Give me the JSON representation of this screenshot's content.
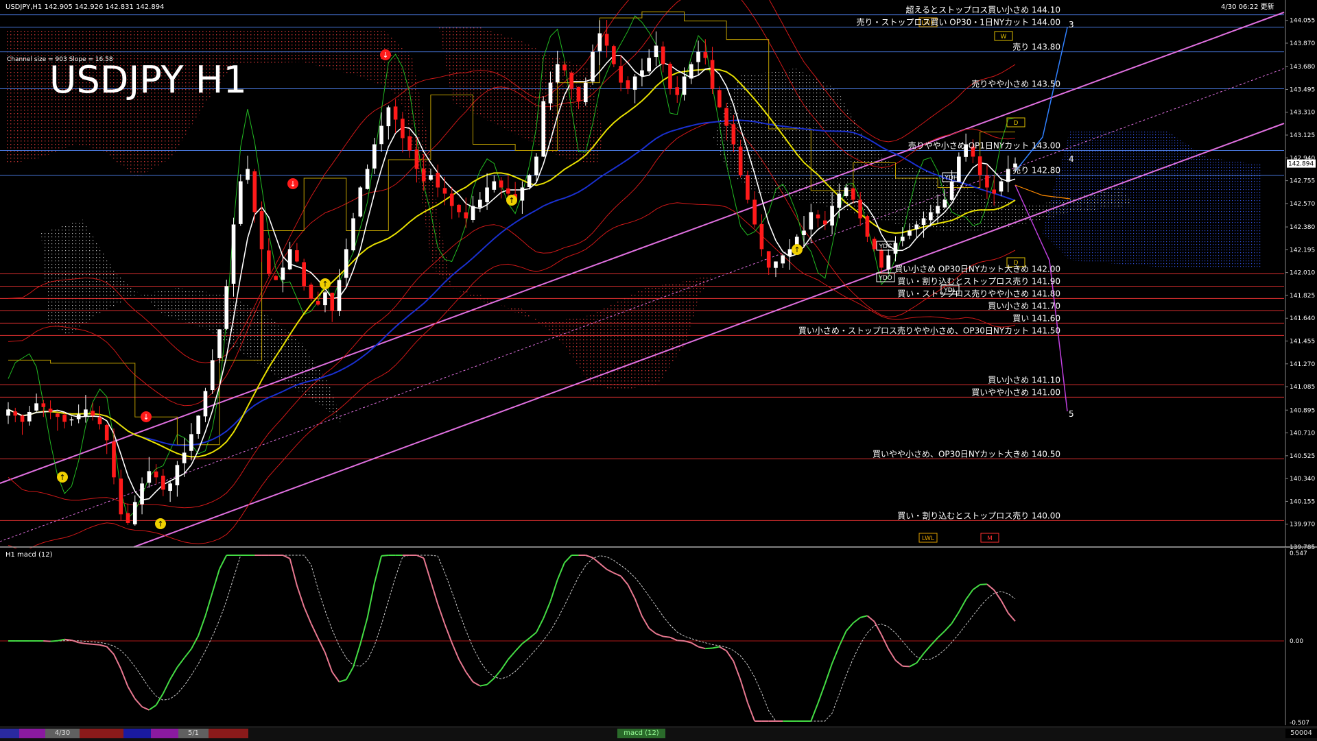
{
  "header": {
    "symbol_info": "USDJPY,H1  142.905 142.926 142.831 142.894",
    "timestamp": "4/30 06:22 更新",
    "big_title": "USDJPY H1",
    "channel_info": "Channel size = 903 Slope = 16.58"
  },
  "price_axis": {
    "labels": [
      "144.055",
      "143.870",
      "143.680",
      "143.495",
      "143.310",
      "143.125",
      "142.940",
      "142.755",
      "142.570",
      "142.380",
      "142.195",
      "142.010",
      "141.825",
      "141.640",
      "141.455",
      "141.270",
      "141.085",
      "140.895",
      "140.710",
      "140.525",
      "140.340",
      "140.155",
      "139.970",
      "139.785"
    ],
    "current_price": "142.894"
  },
  "levels": [
    {
      "label": "超えるとストップロス買い小さめ 144.10",
      "price": 144.1,
      "color": "#4a7ae0"
    },
    {
      "label": "売り・ストップロス買い OP30・1日NYカット 144.00",
      "price": 144.0,
      "color": "#4a7ae0"
    },
    {
      "label": "売り 143.80",
      "price": 143.8,
      "color": "#4a7ae0"
    },
    {
      "label": "売りやや小さめ 143.50",
      "price": 143.5,
      "color": "#4a7ae0"
    },
    {
      "label": "売りやや小さめ OP1日NYカット 143.00",
      "price": 143.0,
      "color": "#4a7ae0"
    },
    {
      "label": "売り 142.80",
      "price": 142.8,
      "color": "#4a7ae0"
    },
    {
      "label": "買い小さめ OP30日NYカット大きめ 142.00",
      "price": 142.0,
      "color": "#e03030"
    },
    {
      "label": "買い・割り込むとストップロス売り 141.90",
      "price": 141.9,
      "color": "#e03030"
    },
    {
      "label": "買い・ストップロス売りやや小さめ 141.80",
      "price": 141.8,
      "color": "#e03030"
    },
    {
      "label": "買い小さめ 141.70",
      "price": 141.7,
      "color": "#e03030"
    },
    {
      "label": "買い 141.60",
      "price": 141.6,
      "color": "#e03030"
    },
    {
      "label": "買い小さめ・ストップロス売りやや小さめ、OP30日NYカット 141.50",
      "price": 141.5,
      "color": "#e03030"
    },
    {
      "label": "買い小さめ 141.10",
      "price": 141.1,
      "color": "#e03030"
    },
    {
      "label": "買いやや小さめ 141.00",
      "price": 141.0,
      "color": "#e03030"
    },
    {
      "label": "買いやや小さめ、OP30日NYカット大きめ 140.50",
      "price": 140.5,
      "color": "#e03030"
    },
    {
      "label": "買い・割り込むとストップロス売り 140.00",
      "price": 140.0,
      "color": "#e03030"
    }
  ],
  "wave_labels": [
    "3",
    "4",
    "5"
  ],
  "markers": {
    "ydh": "YDH",
    "ydl": "YDL",
    "ydc": "YDC",
    "ydo": "YDO",
    "lwh": "LWH",
    "lwl": "LWL",
    "w": "W",
    "d": "D",
    "m": "M"
  },
  "macd": {
    "title": "H1  macd (12)",
    "labels": [
      "0.547",
      "0.00",
      "-0.507"
    ],
    "macd_color": "#44dd44",
    "signal_color": "#cccccc"
  },
  "tabs": {
    "date1": "4/30",
    "date2": "5/1",
    "center": "macd (12)",
    "right": "50004"
  },
  "colors": {
    "ma_fast": "#ffffff",
    "ma_mid": "#e8e000",
    "ma_slow": "#1a30d0",
    "channel": "#e070e0",
    "bull_candle": "#ffffff",
    "bear_candle": "#ff1a1a"
  },
  "chart_data": {
    "type": "candlestick",
    "title": "USDJPY H1",
    "ylim": [
      139.785,
      144.22
    ],
    "series": [
      {
        "name": "USDJPY H1",
        "close_path": [
          140.9,
          140.85,
          140.8,
          140.88,
          140.95,
          140.92,
          140.88,
          140.84,
          140.8,
          140.82,
          140.86,
          140.9,
          140.85,
          140.78,
          140.65,
          140.35,
          140.05,
          139.98,
          140.15,
          140.3,
          140.4,
          140.35,
          140.25,
          140.3,
          140.45,
          140.55,
          140.7,
          140.85,
          141.05,
          141.3,
          141.55,
          141.9,
          142.4,
          142.75,
          142.85,
          142.5,
          142.2,
          142.0,
          141.95,
          142.05,
          142.2,
          142.1,
          141.9,
          141.8,
          141.75,
          141.85,
          141.7,
          141.95,
          142.2,
          142.45,
          142.7,
          142.85,
          143.05,
          143.2,
          143.35,
          143.25,
          143.1,
          143.0,
          142.85,
          142.75,
          142.8,
          142.7,
          142.65,
          142.55,
          142.5,
          142.45,
          142.55,
          142.6,
          142.7,
          142.75,
          142.7,
          142.65,
          142.6,
          142.7,
          142.8,
          142.95,
          143.4,
          143.55,
          143.7,
          143.65,
          143.5,
          143.4,
          143.55,
          143.8,
          143.95,
          143.85,
          143.7,
          143.55,
          143.5,
          143.6,
          143.65,
          143.75,
          143.85,
          143.7,
          143.5,
          143.45,
          143.6,
          143.7,
          143.8,
          143.75,
          143.5,
          143.35,
          143.2,
          143.05,
          142.8,
          142.6,
          142.4,
          142.2,
          142.05,
          142.1,
          142.15,
          142.2,
          142.3,
          142.35,
          142.5,
          142.45,
          142.4,
          142.55,
          142.65,
          142.7,
          142.6,
          142.45,
          142.3,
          142.2,
          142.05,
          142.15,
          142.25,
          142.3,
          142.35,
          142.4,
          142.45,
          142.5,
          142.55,
          142.6,
          142.75,
          142.95,
          143.05,
          142.95,
          142.8,
          142.7,
          142.65,
          142.75,
          142.85,
          142.894
        ]
      }
    ]
  }
}
